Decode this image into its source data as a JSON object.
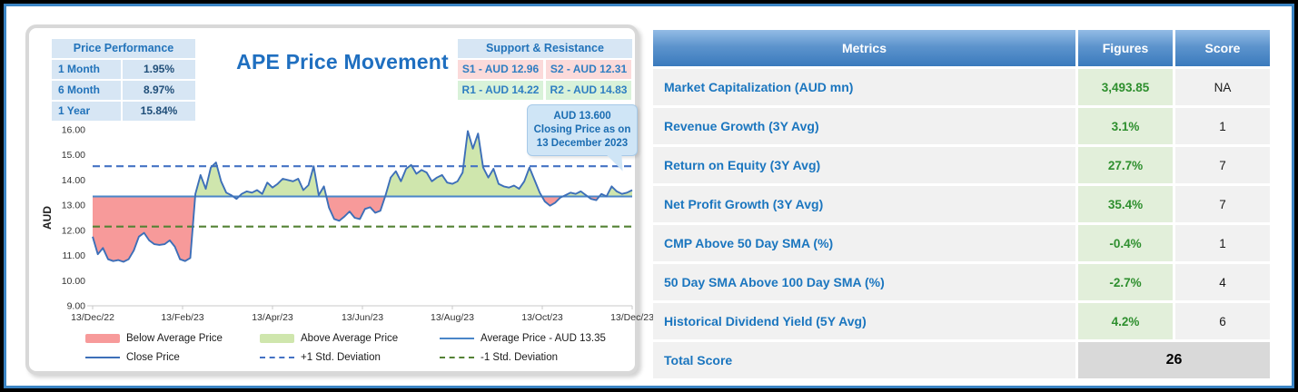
{
  "window": {
    "outer_border_color": "#000000",
    "frame_border_color": "#3b84c4",
    "background": "#ffffff"
  },
  "price_chart": {
    "title": "APE Price Movement",
    "price_performance": {
      "title": "Price Performance",
      "rows": [
        {
          "label": "1 Month",
          "value": "1.95%"
        },
        {
          "label": "6 Month",
          "value": "8.97%"
        },
        {
          "label": "1 Year",
          "value": "15.84%"
        }
      ]
    },
    "support_resistance": {
      "title": "Support & Resistance",
      "supports": [
        "S1 - AUD 12.96",
        "S2 - AUD 12.31"
      ],
      "resistances": [
        "R1 - AUD 14.22",
        "R2 - AUD 14.83"
      ]
    },
    "callout": {
      "text": "AUD 13.600 Closing Price as on 13 December 2023"
    }
  },
  "chart_data": {
    "type": "area",
    "title": "APE Price Movement",
    "xlabel": "",
    "ylabel": "AUD",
    "ylim": [
      9,
      16
    ],
    "y_ticks": [
      "16.00",
      "15.00",
      "14.00",
      "13.00",
      "12.00",
      "11.00",
      "10.00",
      "9.00"
    ],
    "x_ticks": [
      "13/Dec/22",
      "13/Feb/23",
      "13/Apr/23",
      "13/Jun/23",
      "13/Aug/23",
      "13/Oct/23",
      "13/Dec/23"
    ],
    "average_price": 13.35,
    "plus1_std_deviation": 14.55,
    "minus1_std_deviation": 12.15,
    "closing_price_latest": 13.6,
    "close_prices": [
      11.75,
      11.05,
      11.3,
      10.85,
      10.78,
      10.82,
      10.75,
      10.85,
      11.2,
      11.75,
      11.9,
      11.6,
      11.45,
      11.42,
      11.45,
      11.6,
      11.35,
      10.85,
      10.78,
      10.9,
      13.45,
      14.2,
      13.65,
      14.5,
      14.7,
      13.95,
      13.5,
      13.4,
      13.25,
      13.45,
      13.55,
      13.5,
      13.6,
      13.45,
      13.9,
      13.7,
      13.85,
      14.05,
      14.0,
      13.95,
      14.05,
      13.6,
      13.8,
      14.55,
      13.4,
      13.75,
      12.9,
      12.45,
      12.38,
      12.55,
      12.75,
      12.5,
      12.45,
      12.85,
      12.92,
      12.7,
      12.78,
      13.4,
      14.1,
      14.35,
      13.95,
      14.45,
      14.6,
      14.25,
      14.4,
      14.3,
      13.95,
      14.1,
      14.2,
      13.9,
      13.85,
      13.95,
      14.3,
      15.95,
      15.25,
      15.85,
      14.5,
      14.1,
      14.45,
      13.85,
      13.75,
      13.7,
      13.78,
      13.65,
      13.95,
      14.5,
      14.0,
      13.5,
      13.15,
      12.98,
      13.1,
      13.3,
      13.4,
      13.5,
      13.45,
      13.55,
      13.4,
      13.25,
      13.2,
      13.45,
      13.35,
      13.75,
      13.55,
      13.45,
      13.5,
      13.6
    ],
    "legend": [
      {
        "label": "Below Average Price",
        "style": "area",
        "color": "#f79a9a"
      },
      {
        "label": "Above Average Price",
        "style": "area",
        "color": "#cfe6ad"
      },
      {
        "label": "Average Price - AUD 13.35",
        "style": "line",
        "color": "#4a86c8"
      },
      {
        "label": "Close Price",
        "style": "line",
        "color": "#3d6fb8"
      },
      {
        "label": "+1 Std. Deviation",
        "style": "dashed",
        "color": "#4472c4"
      },
      {
        "label": "-1 Std. Deviation",
        "style": "dashed",
        "color": "#548235"
      }
    ],
    "colors": {
      "close_line": "#3d6fb8",
      "average_line": "#4a86c8",
      "plus1_line": "#4472c4",
      "minus1_line": "#548235",
      "above_fill": "#cfe6ad",
      "below_fill": "#f79a9a",
      "axis_text": "#333333",
      "axis_line": "#c9c9c9"
    },
    "grid": "off",
    "legend_position": "bottom"
  },
  "metrics_table": {
    "headers": [
      "Metrics",
      "Figures",
      "Score"
    ],
    "rows": [
      {
        "metric": "Market Capitalization (AUD mn)",
        "figure": "3,493.85",
        "score": "NA"
      },
      {
        "metric": "Revenue Growth (3Y Avg)",
        "figure": "3.1%",
        "score": "1"
      },
      {
        "metric": "Return on Equity (3Y Avg)",
        "figure": "27.7%",
        "score": "7"
      },
      {
        "metric": "Net Profit Growth (3Y Avg)",
        "figure": "35.4%",
        "score": "7"
      },
      {
        "metric": "CMP Above 50 Day SMA (%)",
        "figure": "-0.4%",
        "score": "1"
      },
      {
        "metric": "50 Day SMA Above 100 Day SMA (%)",
        "figure": "-2.7%",
        "score": "4"
      },
      {
        "metric": "Historical Dividend Yield (5Y Avg)",
        "figure": "4.2%",
        "score": "6"
      }
    ],
    "total": {
      "label": "Total Score",
      "value": "26"
    },
    "theme": {
      "header_gradient_top": "#93bce5",
      "header_gradient_bottom": "#3a7abd",
      "metric_text": "#1b76bf",
      "figure_text": "#2e8f2e",
      "figure_bg": "#e2efda",
      "row_bg": "#f1f1f1",
      "total_bg": "#d9d9d9"
    }
  }
}
